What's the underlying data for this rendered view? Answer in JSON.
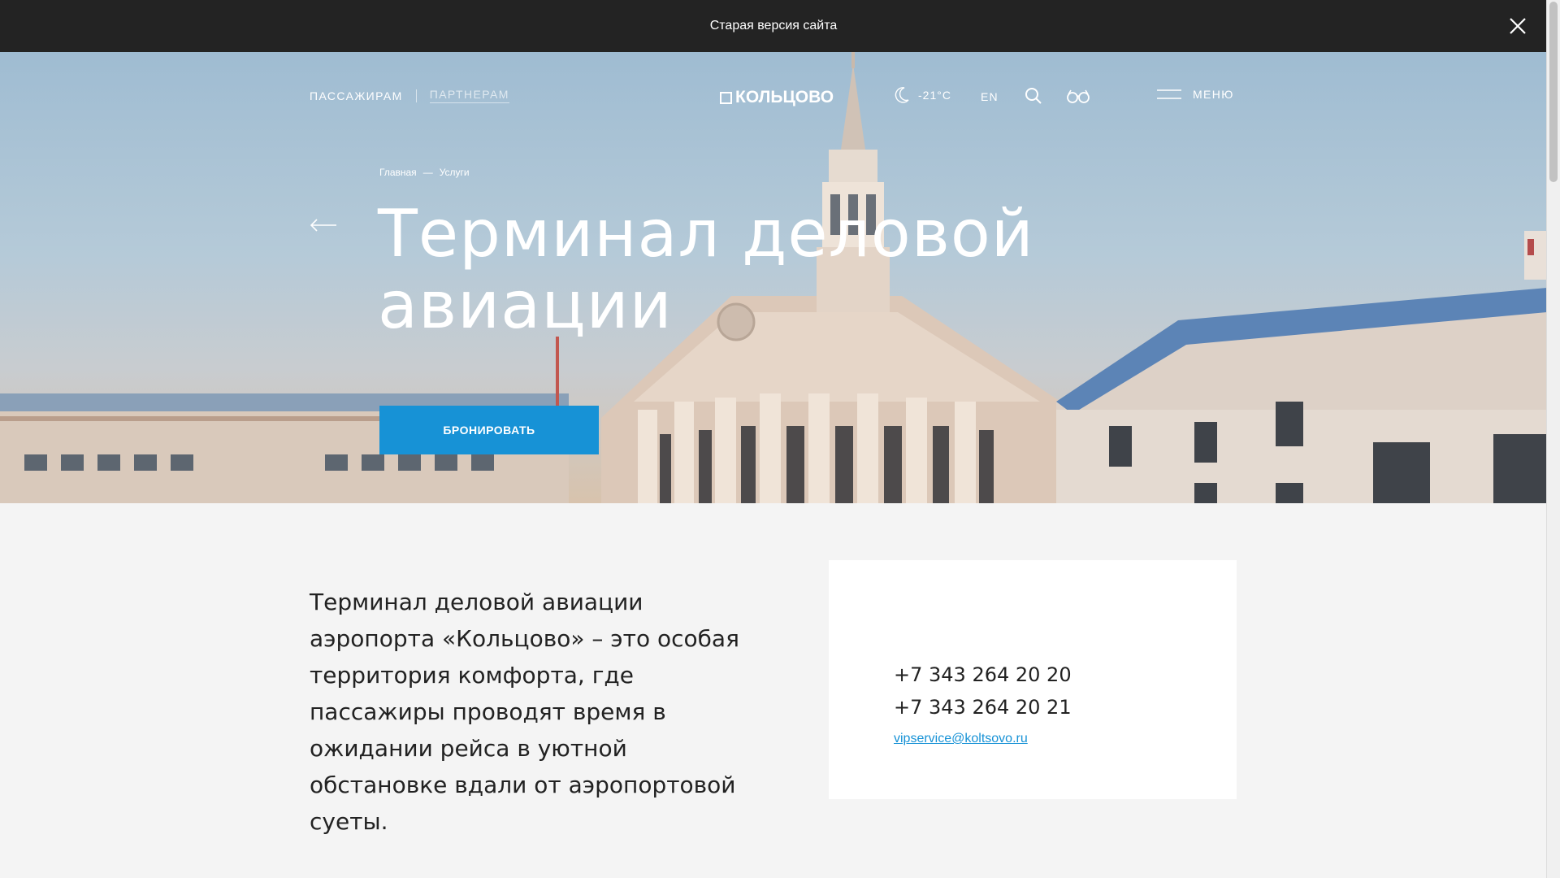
{
  "banner": {
    "text": "Старая версия сайта",
    "close_icon": "close-icon"
  },
  "header": {
    "nav_passengers": "ПАССАЖИРАМ",
    "nav_partners": "ПАРТНЕРАМ",
    "logo_text": "КОЛЬЦОВО",
    "weather_icon": "moon-icon",
    "weather_temp": "-21°C",
    "lang": "EN",
    "search_icon": "search-icon",
    "accessibility_icon": "glasses-icon",
    "menu_label": "МЕНЮ",
    "menu_icon": "hamburger-icon"
  },
  "breadcrumb": {
    "items": [
      "Главная",
      "Услуги"
    ],
    "separator": "—"
  },
  "hero": {
    "title_line1": "Терминал деловой",
    "title_line2": "авиации",
    "button_label": "БРОНИРОВАТЬ",
    "back_icon": "arrow-left-icon"
  },
  "content": {
    "lead_text": "Терминал деловой авиации аэропорта «Кольцово» – это особая территория комфорта, где пассажиры проводят время в ожидании рейса в уютной обстановке вдали от аэропортовой суеты."
  },
  "contacts": {
    "phone1": "+7 343 264 20 20",
    "phone2": "+7 343 264 20 21",
    "email": "vipservice@koltsovo.ru"
  },
  "colors": {
    "accent": "#1792d6",
    "banner_bg": "#232323",
    "page_bg": "#f4f4f4"
  }
}
